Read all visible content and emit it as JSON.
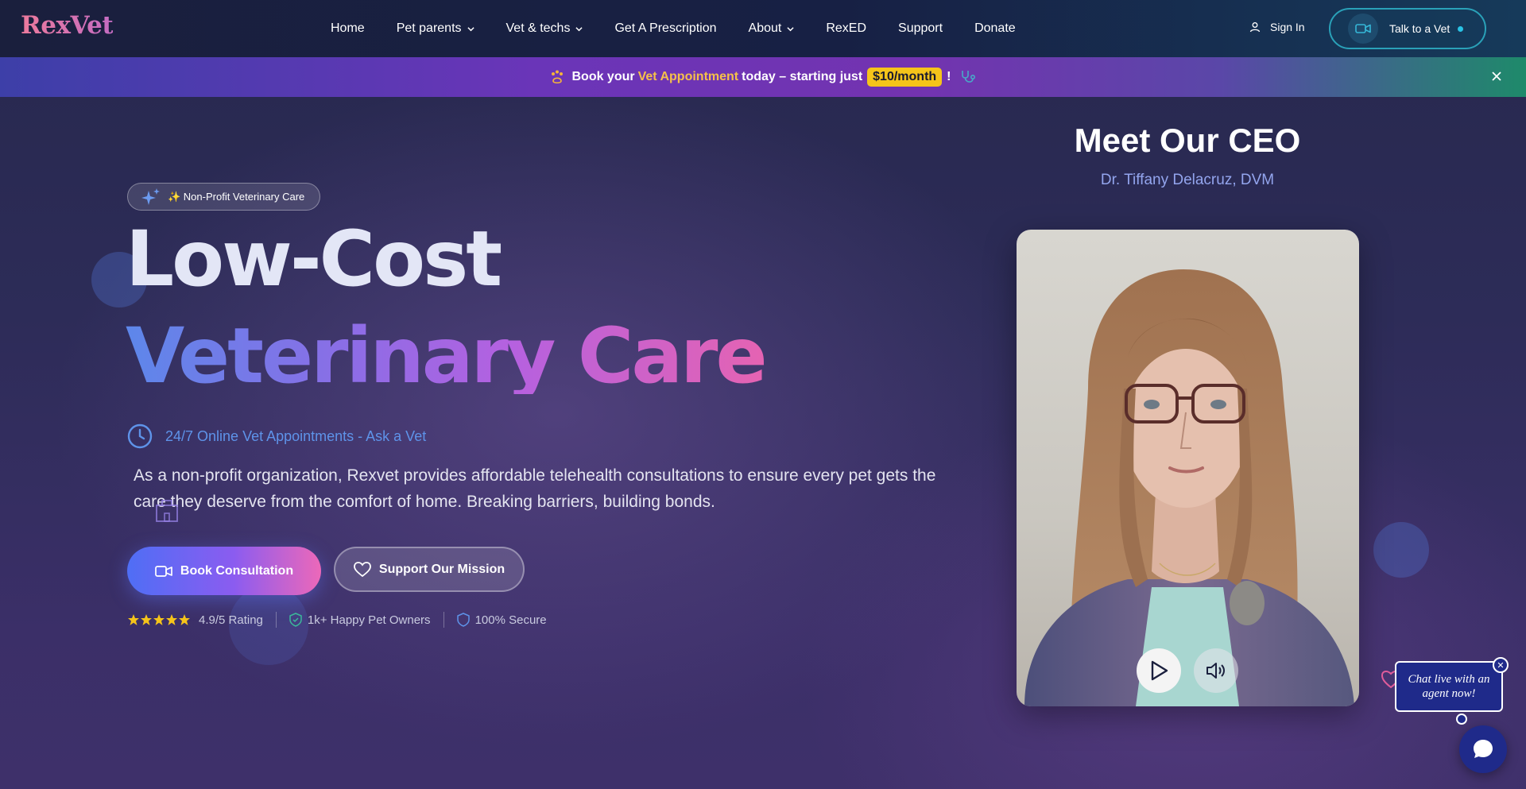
{
  "brand": {
    "logo_text": "RexVet"
  },
  "nav": {
    "items": [
      {
        "label": "Home",
        "dropdown": false
      },
      {
        "label": "Pet parents",
        "dropdown": true
      },
      {
        "label": "Vet & techs",
        "dropdown": true
      },
      {
        "label": "Get A Prescription",
        "dropdown": false
      },
      {
        "label": "About",
        "dropdown": true
      },
      {
        "label": "RexED",
        "dropdown": false
      },
      {
        "label": "Support",
        "dropdown": false
      },
      {
        "label": "Donate",
        "dropdown": false
      }
    ],
    "sign_in": "Sign In",
    "talk_to_vet": "Talk to a Vet"
  },
  "promo": {
    "prefix": "Book your",
    "highlight": "Vet Appointment",
    "middle": "today – starting just",
    "price": "$10/month",
    "suffix": "!"
  },
  "hero": {
    "badge": "✨ Non-Profit Veterinary Care",
    "title_line1": "Low-Cost",
    "title_line2": "Veterinary Care",
    "availability": "24/7 Online Vet Appointments - Ask a Vet",
    "description": "As a non-profit organization, Rexvet provides affordable telehealth consultations to ensure every pet gets the care they deserve from the comfort of home. Breaking barriers, building bonds.",
    "primary_button": "Book Consultation",
    "secondary_button": "Support Our Mission",
    "stats": {
      "rating": "4.9/5 Rating",
      "stars": 5,
      "owners": "1k+ Happy Pet Owners",
      "secure": "100% Secure"
    }
  },
  "ceo": {
    "title": "Meet Our CEO",
    "name": "Dr. Tiffany Delacruz, DVM"
  },
  "chat": {
    "prompt": "Chat live with an agent now!",
    "close": "✕"
  },
  "colors": {
    "accent_blue": "#5e93e9",
    "brand_pink": "#ec7a9d",
    "price_yellow": "#f5c41a",
    "chat_navy": "#1f2a8a"
  }
}
